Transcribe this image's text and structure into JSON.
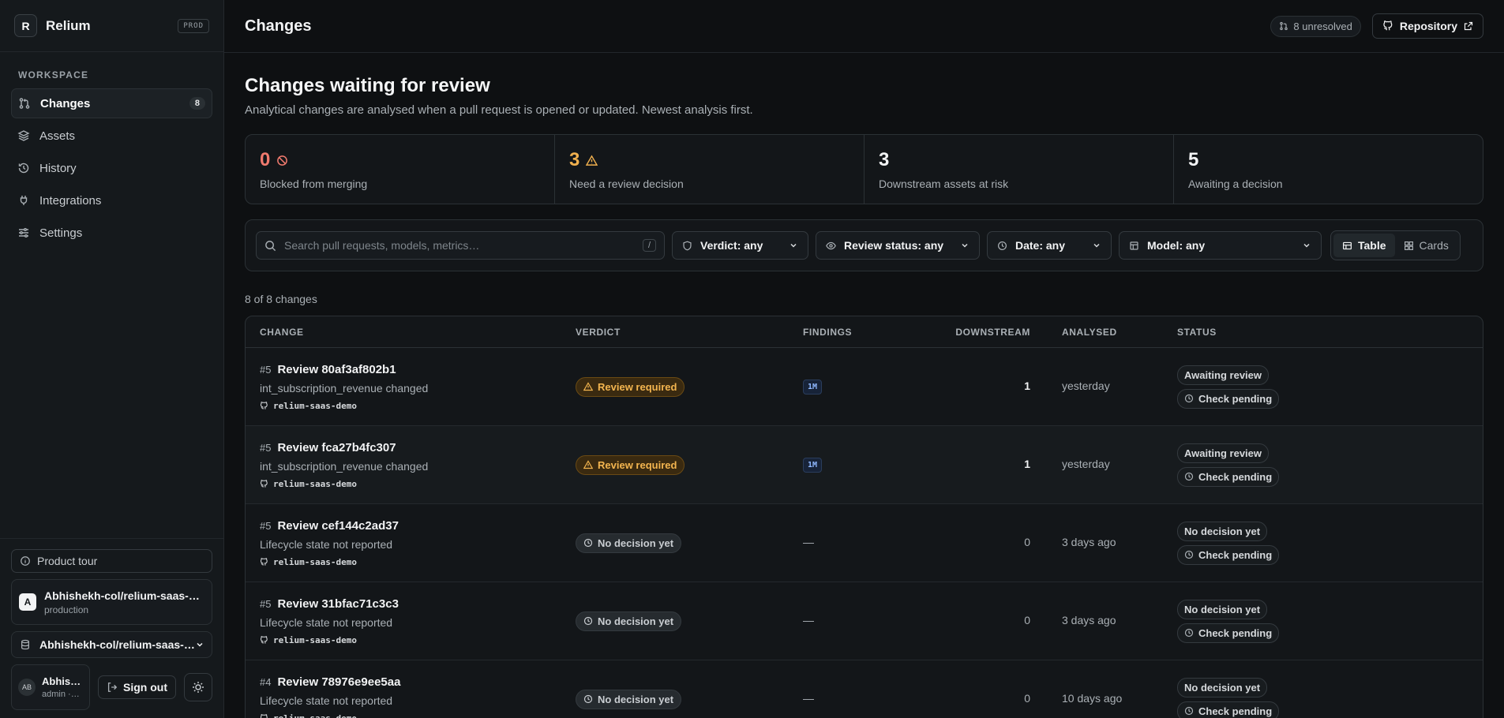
{
  "brand": {
    "logo_letter": "R",
    "name": "Relium",
    "env_badge": "PROD"
  },
  "sidebar": {
    "section_label": "WORKSPACE",
    "items": [
      {
        "label": "Changes",
        "icon": "git-pull-request-icon",
        "count": "8",
        "active": true
      },
      {
        "label": "Assets",
        "icon": "layers-icon"
      },
      {
        "label": "History",
        "icon": "history-icon"
      },
      {
        "label": "Integrations",
        "icon": "plug-icon"
      },
      {
        "label": "Settings",
        "icon": "sliders-icon"
      }
    ],
    "product_tour": "Product tour",
    "project": {
      "avatar": "A",
      "name": "Abhishekh-col/relium-saas-demo",
      "env": "production"
    },
    "repo_select": "Abhishekh-col/relium-saas-demo",
    "user": {
      "initials": "AB",
      "name": "Abhishekh",
      "role": "admin · owner"
    },
    "sign_out": "Sign out"
  },
  "topbar": {
    "title": "Changes",
    "unresolved": "8 unresolved",
    "repository_button": "Repository"
  },
  "header": {
    "title": "Changes waiting for review",
    "subtitle": "Analytical changes are analysed when a pull request is opened or updated. Newest analysis first."
  },
  "stats": [
    {
      "value": "0",
      "label": "Blocked from merging",
      "color": "#f07a6e"
    },
    {
      "value": "3",
      "label": "Need a review decision",
      "color": "#f0b04e"
    },
    {
      "value": "3",
      "label": "Downstream assets at risk"
    },
    {
      "value": "5",
      "label": "Awaiting a decision"
    }
  ],
  "filters": {
    "search_placeholder": "Search pull requests, models, metrics…",
    "search_shortcut": "/",
    "verdict": "Verdict: any",
    "review_status": "Review status: any",
    "date": "Date: any",
    "model": "Model: any",
    "view_table": "Table",
    "view_cards": "Cards"
  },
  "count_line": "8 of 8 changes",
  "table": {
    "columns": [
      "CHANGE",
      "VERDICT",
      "FINDINGS",
      "DOWNSTREAM",
      "ANALYSED",
      "STATUS"
    ],
    "rows": [
      {
        "pr": "#5",
        "title": "Review 80af3af802b1",
        "desc": "int_subscription_revenue changed",
        "repo": "relium-saas-demo",
        "verdict": "Review required",
        "verdict_kind": "review",
        "findings": "1M",
        "downstream": "1",
        "analysed": "yesterday",
        "status1": "Awaiting review",
        "status2": "Check pending"
      },
      {
        "pr": "#5",
        "title": "Review fca27b4fc307",
        "desc": "int_subscription_revenue changed",
        "repo": "relium-saas-demo",
        "verdict": "Review required",
        "verdict_kind": "review",
        "findings": "1M",
        "downstream": "1",
        "analysed": "yesterday",
        "status1": "Awaiting review",
        "status2": "Check pending"
      },
      {
        "pr": "#5",
        "title": "Review cef144c2ad37",
        "desc": "Lifecycle state not reported",
        "repo": "relium-saas-demo",
        "verdict": "No decision yet",
        "verdict_kind": "none",
        "findings": "—",
        "downstream": "0",
        "analysed": "3 days ago",
        "status1": "No decision yet",
        "status2": "Check pending"
      },
      {
        "pr": "#5",
        "title": "Review 31bfac71c3c3",
        "desc": "Lifecycle state not reported",
        "repo": "relium-saas-demo",
        "verdict": "No decision yet",
        "verdict_kind": "none",
        "findings": "—",
        "downstream": "0",
        "analysed": "3 days ago",
        "status1": "No decision yet",
        "status2": "Check pending"
      },
      {
        "pr": "#4",
        "title": "Review 78976e9ee5aa",
        "desc": "Lifecycle state not reported",
        "repo": "relium-saas-demo",
        "verdict": "No decision yet",
        "verdict_kind": "none",
        "findings": "—",
        "downstream": "0",
        "analysed": "10 days ago",
        "status1": "No decision yet",
        "status2": "Check pending"
      }
    ]
  }
}
